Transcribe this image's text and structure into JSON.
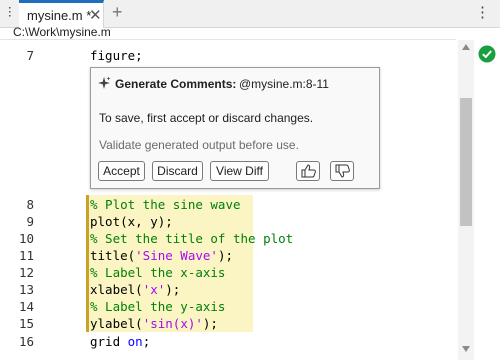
{
  "tab": {
    "title": "mysine.m *",
    "close_glyph": "✕",
    "add_glyph": "+",
    "more_glyph": "⋮",
    "active_color": "#1f6ebd"
  },
  "breadcrumb": "C:\\Work\\mysine.m",
  "code_lines": [
    {
      "number": "7",
      "segments": [
        {
          "text": "figure;",
          "kind": "plain"
        }
      ]
    },
    {
      "number": "8",
      "segments": [
        {
          "text": "% Plot the sine wave",
          "kind": "comment"
        }
      ]
    },
    {
      "number": "9",
      "segments": [
        {
          "text": "plot(x, y);",
          "kind": "plain"
        }
      ]
    },
    {
      "number": "10",
      "segments": [
        {
          "text": "% Set the title of the plot",
          "kind": "comment"
        }
      ]
    },
    {
      "number": "11",
      "segments": [
        {
          "text": "title(",
          "kind": "plain"
        },
        {
          "text": "'Sine Wave'",
          "kind": "string"
        },
        {
          "text": ");",
          "kind": "plain"
        }
      ]
    },
    {
      "number": "12",
      "segments": [
        {
          "text": "% Label the x-axis",
          "kind": "comment"
        }
      ]
    },
    {
      "number": "13",
      "segments": [
        {
          "text": "xlabel(",
          "kind": "plain"
        },
        {
          "text": "'x'",
          "kind": "string"
        },
        {
          "text": ");",
          "kind": "plain"
        }
      ]
    },
    {
      "number": "14",
      "segments": [
        {
          "text": "% Label the y-axis",
          "kind": "comment"
        }
      ]
    },
    {
      "number": "15",
      "segments": [
        {
          "text": "ylabel(",
          "kind": "plain"
        },
        {
          "text": "'sin(x)'",
          "kind": "string"
        },
        {
          "text": ");",
          "kind": "plain"
        }
      ]
    },
    {
      "number": "16",
      "segments": [
        {
          "text": "grid ",
          "kind": "plain"
        },
        {
          "text": "on",
          "kind": "keyword"
        },
        {
          "text": ";",
          "kind": "plain"
        }
      ]
    }
  ],
  "popup": {
    "title": "Generate Comments:",
    "reference": "@mysine.m:8-11",
    "message": "To save, first accept or discard changes.",
    "note": "Validate generated output before use.",
    "accept_label": "Accept",
    "discard_label": "Discard",
    "view_diff_label": "View Diff",
    "sparkle_icon": "sparkle-icon",
    "thumbs_up_icon": "thumbs-up-icon",
    "thumbs_down_icon": "thumbs-down-icon"
  },
  "status": {
    "icon": "check-circle-icon",
    "color": "#1a9e3f"
  },
  "colors": {
    "comment": "#028009",
    "string": "#a709f5",
    "keyword": "#0e00ff",
    "generated_highlight": "#fbf4c3",
    "generated_bar": "#c9a227"
  }
}
